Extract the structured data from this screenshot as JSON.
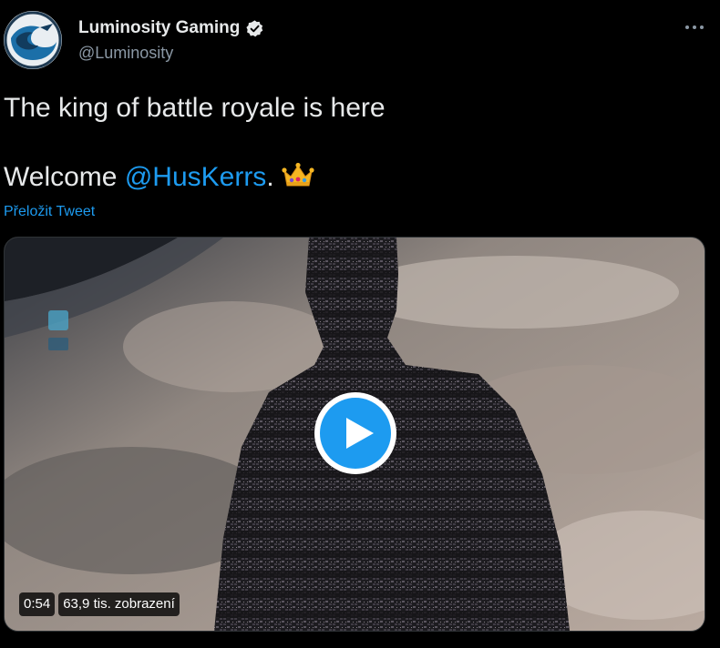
{
  "author": {
    "display_name": "Luminosity Gaming",
    "handle": "@Luminosity",
    "verified_icon": "verified-badge-icon",
    "avatar_icon": "luminosity-logo-icon"
  },
  "tweet": {
    "line1": "The king of battle royale is here",
    "line2_prefix": "Welcome ",
    "mention": "@HusKerrs",
    "line2_suffix": ".",
    "emoji_icon": "crown-icon",
    "translate": "Přeložit Tweet"
  },
  "media": {
    "duration": "0:54",
    "views": "63,9 tis. zobrazení",
    "play_icon": "play-icon"
  },
  "colors": {
    "background": "#000000",
    "text": "#e7e9ea",
    "secondary": "#8b98a5",
    "accent": "#1d9bf0"
  }
}
